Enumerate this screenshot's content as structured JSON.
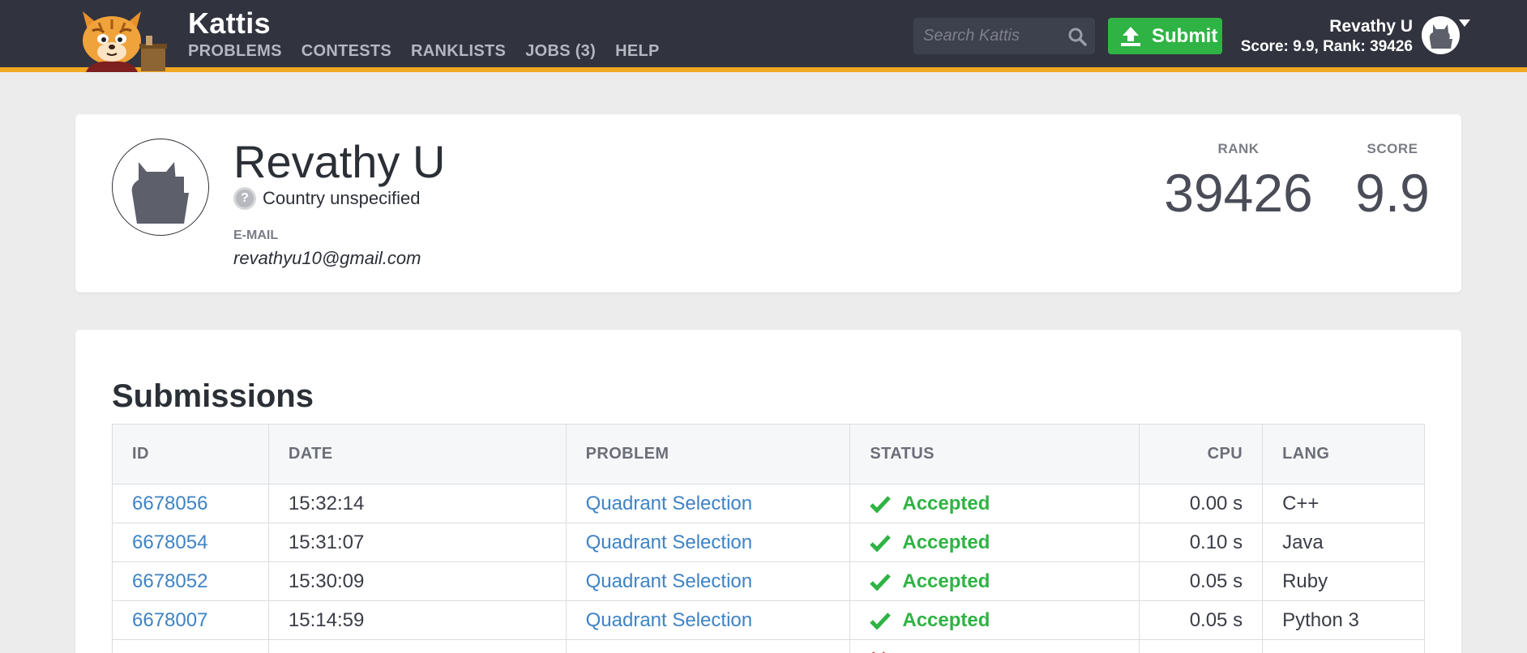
{
  "header": {
    "brand": "Kattis",
    "nav": [
      "PROBLEMS",
      "CONTESTS",
      "RANKLISTS",
      "JOBS (3)",
      "HELP"
    ],
    "search_placeholder": "Search Kattis",
    "submit_label": "Submit",
    "user_name": "Revathy U",
    "user_score": "Score: 9.9, Rank: 39426"
  },
  "profile": {
    "name": "Revathy U",
    "country": "Country unspecified",
    "email_label": "E-MAIL",
    "email": "revathyu10@gmail.com",
    "rank_label": "RANK",
    "rank": "39426",
    "score_label": "SCORE",
    "score": "9.9"
  },
  "submissions": {
    "title": "Submissions",
    "columns": [
      "ID",
      "DATE",
      "PROBLEM",
      "STATUS",
      "CPU",
      "LANG"
    ],
    "rows": [
      {
        "id": "6678056",
        "date": "15:32:14",
        "problem": "Quadrant Selection",
        "status": "Accepted",
        "cpu": "0.00 s",
        "lang": "C++"
      },
      {
        "id": "6678054",
        "date": "15:31:07",
        "problem": "Quadrant Selection",
        "status": "Accepted",
        "cpu": "0.10 s",
        "lang": "Java"
      },
      {
        "id": "6678052",
        "date": "15:30:09",
        "problem": "Quadrant Selection",
        "status": "Accepted",
        "cpu": "0.05 s",
        "lang": "Ruby"
      },
      {
        "id": "6678007",
        "date": "15:14:59",
        "problem": "Quadrant Selection",
        "status": "Accepted",
        "cpu": "0.05 s",
        "lang": "Python 3"
      },
      {
        "id": "",
        "date": "",
        "problem": "",
        "status": "",
        "cpu": "",
        "lang": ""
      }
    ]
  },
  "colors": {
    "topbar": "#31333f",
    "accent": "#f1a820",
    "submit_green": "#2fb344",
    "link_blue": "#3e83c6",
    "rejected_red": "#d9363e"
  },
  "icons": [
    "kattis-logo-icon",
    "search-icon",
    "upload-icon",
    "avatar-silhouette-icon",
    "question-icon",
    "check-icon",
    "x-icon",
    "caret-down-icon"
  ]
}
